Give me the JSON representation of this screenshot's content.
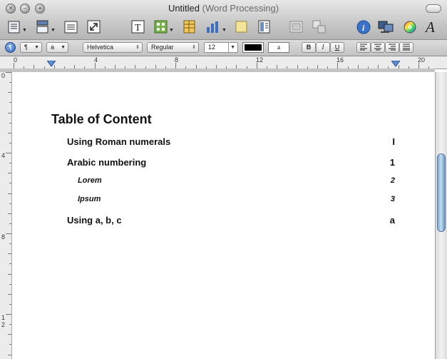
{
  "window": {
    "title": "Untitled",
    "subtitle": "(Word Processing)",
    "controls": [
      "close",
      "minimize",
      "zoom"
    ]
  },
  "toolbar": {
    "icons": [
      "view-icon",
      "sections-icon",
      "table-of-contents-icon",
      "fullscreen-icon",
      "text-box-icon",
      "shapes-icon",
      "table-icon",
      "chart-icon",
      "comment-icon",
      "inspector-columns-icon",
      "media-icon",
      "group-icon",
      "info-icon",
      "adjust-image-icon",
      "colors-icon",
      "fonts-icon"
    ]
  },
  "formatbar": {
    "paragraph_style": "¶",
    "char_style": "a",
    "font_family": "Helvetica",
    "font_style": "Regular",
    "font_size": "12",
    "text_color": "#000000",
    "highlight_label": "a",
    "bold": "B",
    "italic": "I",
    "underline": "U"
  },
  "ruler": {
    "labels": [
      "0",
      "4",
      "8",
      "12",
      "16",
      "20"
    ]
  },
  "vruler": {
    "labels": [
      "0",
      "4",
      "8",
      "1",
      "2"
    ]
  },
  "document": {
    "heading": "Table of Content",
    "entries": [
      {
        "text": "Using Roman numerals",
        "page": "I",
        "level": 1
      },
      {
        "text": "Arabic numbering",
        "page": "1",
        "level": 1
      },
      {
        "text": "Lorem",
        "page": "2",
        "level": 2
      },
      {
        "text": "Ipsum",
        "page": "3",
        "level": 2
      },
      {
        "text": "Using a, b, c",
        "page": "a",
        "level": 1
      }
    ]
  },
  "colors": {
    "accent": "#3b73c8",
    "scroll_thumb": "#8fb3da"
  }
}
